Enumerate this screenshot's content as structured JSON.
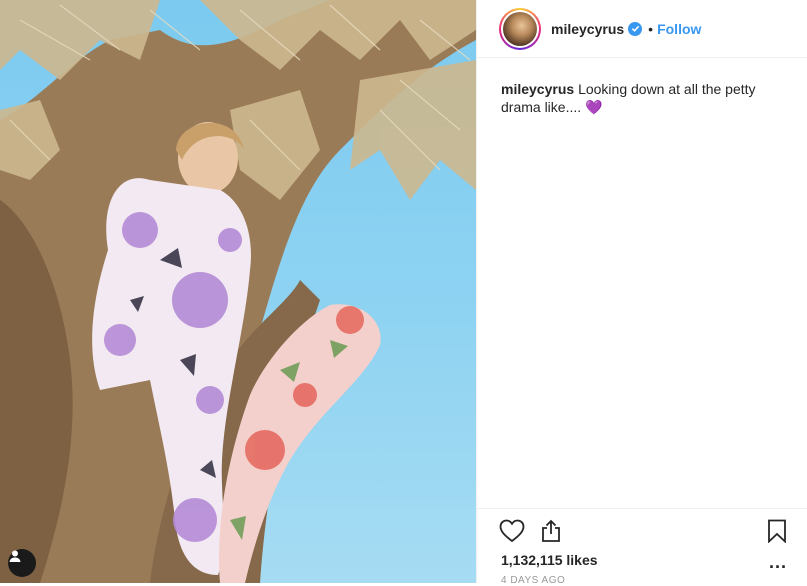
{
  "post": {
    "username": "mileycyrus",
    "follow_label": "Follow",
    "separator": "•",
    "caption_text": "Looking down at all the petty drama like....",
    "caption_emoji": "💜",
    "likes": "1,132,115 likes",
    "more_label": "...",
    "timestamp": "4 DAYS AGO"
  },
  "icons": {
    "verified": "verified-badge-icon",
    "like": "heart-icon",
    "share": "share-icon",
    "save": "bookmark-icon",
    "tag": "user-tag-icon"
  },
  "colors": {
    "link": "#3897f0",
    "text": "#262626",
    "emoji": "#9b2ce0",
    "sky": "#8fd3f2"
  }
}
